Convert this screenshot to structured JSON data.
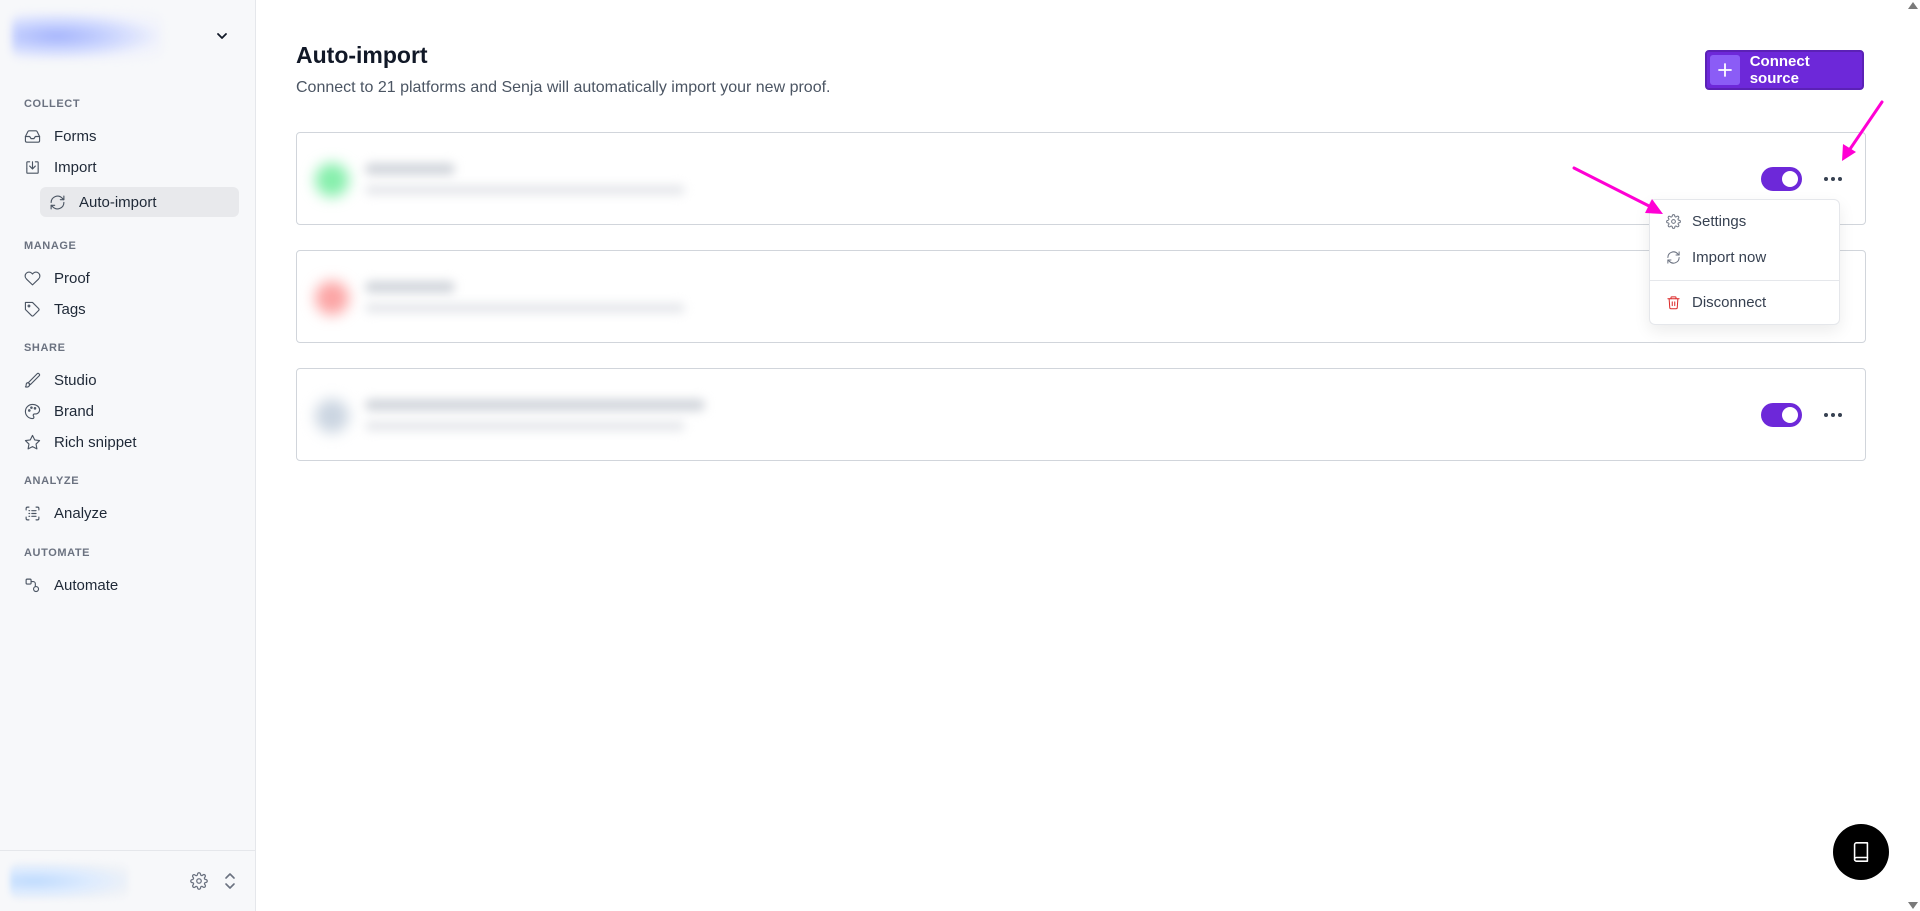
{
  "sidebar": {
    "sections": {
      "collect": "COLLECT",
      "manage": "MANAGE",
      "share": "SHARE",
      "analyze": "ANALYZE",
      "automate": "AUTOMATE"
    },
    "items": {
      "forms": "Forms",
      "import": "Import",
      "auto_import": "Auto-import",
      "proof": "Proof",
      "tags": "Tags",
      "studio": "Studio",
      "brand": "Brand",
      "rich_snippet": "Rich snippet",
      "analyze": "Analyze",
      "automate": "Automate"
    }
  },
  "main": {
    "title": "Auto-import",
    "subtitle": "Connect to 21 platforms and Senja will automatically import your new proof.",
    "connect_button": "Connect source"
  },
  "sources": [
    {
      "logo_color": "#86efac",
      "toggle_on": true,
      "toggle_visible": true
    },
    {
      "logo_color": "#fca5a5",
      "toggle_on": true,
      "toggle_visible": false
    },
    {
      "logo_color": "#cbd5e1",
      "toggle_on": true,
      "toggle_visible": true
    }
  ],
  "dropdown_menu": {
    "settings": "Settings",
    "import_now": "Import now",
    "disconnect": "Disconnect"
  },
  "colors": {
    "accent": "#6d28d9",
    "annotation_arrow": "#ff00d4",
    "danger": "#dc2626"
  }
}
